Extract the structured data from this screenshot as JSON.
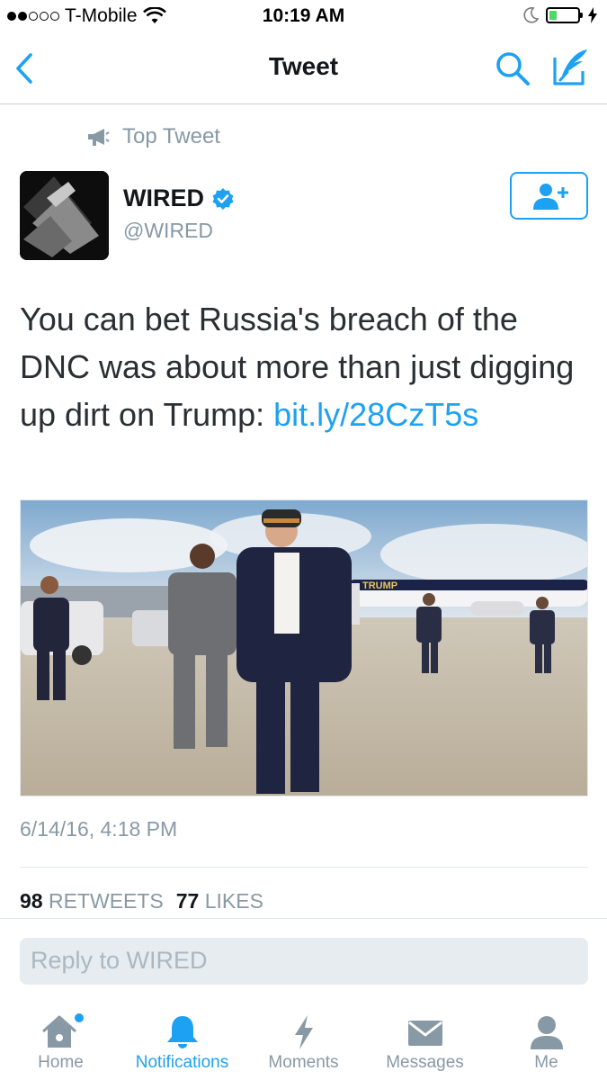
{
  "status_bar": {
    "carrier": "T-Mobile",
    "time": "10:19 AM",
    "battery_percent": 25
  },
  "nav": {
    "title": "Tweet"
  },
  "tweet": {
    "context_label": "Top Tweet",
    "author": {
      "name": "WIRED",
      "handle": "@WIRED",
      "verified": true
    },
    "text": "You can bet Russia's breach of the DNC was about more than just digging up dirt on Trump: ",
    "link": "bit.ly/28CzT5s",
    "timestamp": "6/14/16, 4:18 PM",
    "retweets_count": "98",
    "retweets_label": "RETWEETS",
    "likes_count": "77",
    "likes_label": "LIKES",
    "photo_sign_text": "TRUMP"
  },
  "reply": {
    "placeholder": "Reply to WIRED"
  },
  "tabs": [
    {
      "label": "Home",
      "icon": "home-icon",
      "has_badge": true
    },
    {
      "label": "Notifications",
      "icon": "bell-icon",
      "active": true
    },
    {
      "label": "Moments",
      "icon": "lightning-icon"
    },
    {
      "label": "Messages",
      "icon": "envelope-icon"
    },
    {
      "label": "Me",
      "icon": "person-icon"
    }
  ],
  "colors": {
    "accent": "#1da1f2",
    "muted": "#8899a6",
    "text": "#292f33"
  }
}
